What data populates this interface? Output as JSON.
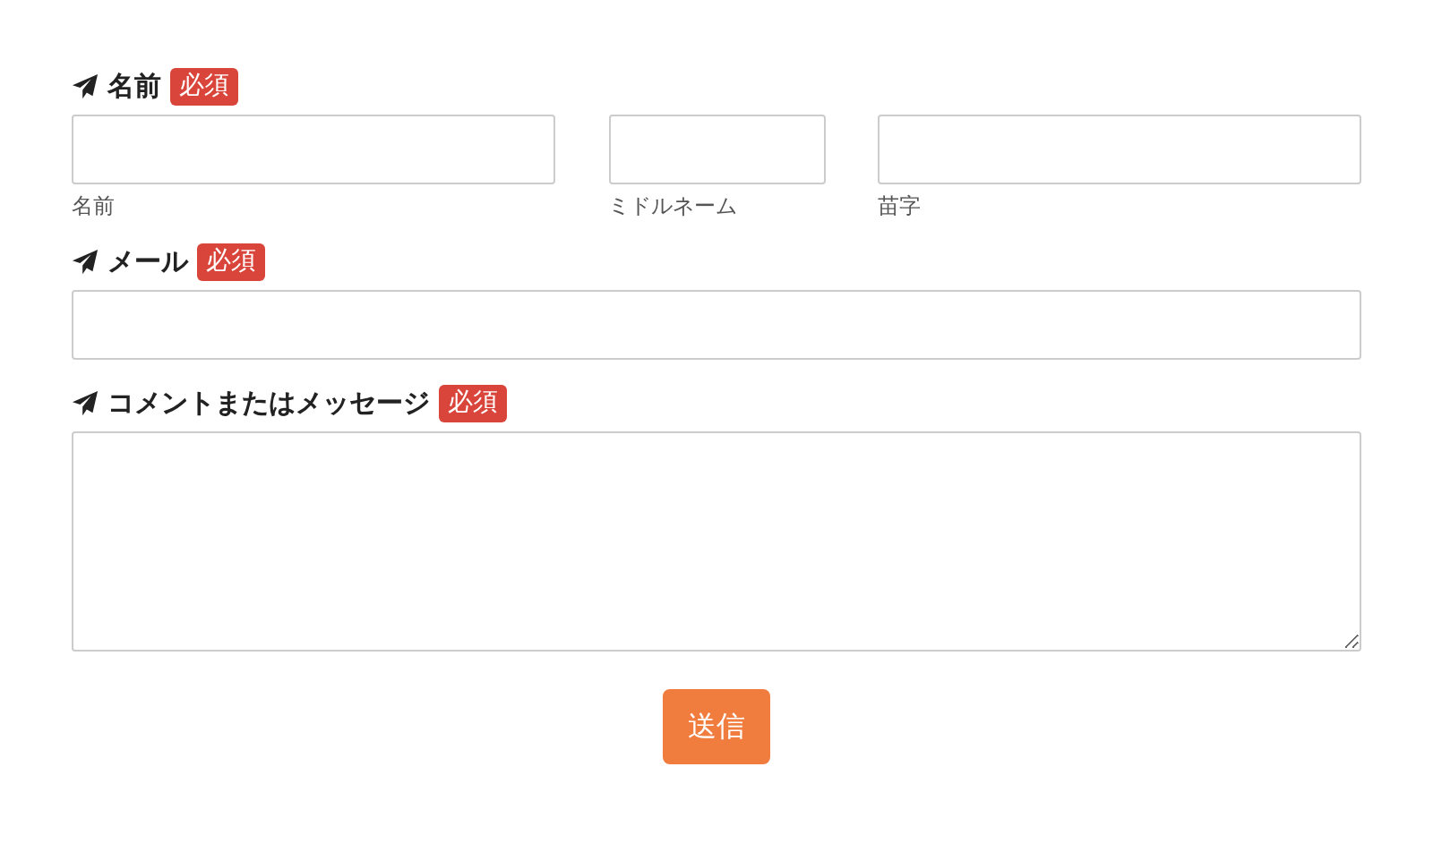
{
  "fields": [
    {
      "kind": "name_group",
      "label": "名前",
      "required": true,
      "required_badge": "必須",
      "parts": [
        {
          "caption": "名前"
        },
        {
          "caption": "ミドルネーム"
        },
        {
          "caption": "苗字"
        }
      ]
    },
    {
      "kind": "text",
      "label": "メール",
      "required": true,
      "required_badge": "必須"
    },
    {
      "kind": "textarea",
      "label": "コメントまたはメッセージ",
      "required": true,
      "required_badge": "必須"
    }
  ],
  "submit_button": "送信"
}
